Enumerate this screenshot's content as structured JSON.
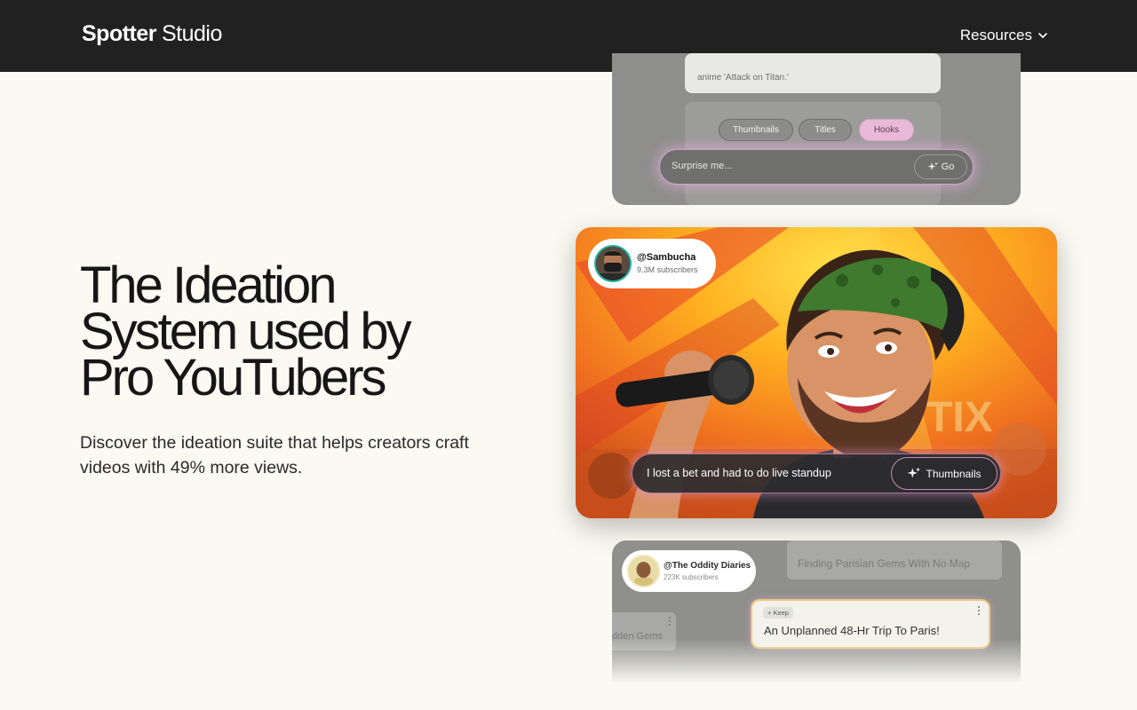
{
  "header": {
    "brand": "Spotter",
    "brand_sub": "Studio",
    "resources_label": "Resources"
  },
  "hero": {
    "title_line1": "The Ideation",
    "title_line2": "System used by",
    "title_line3": "Pro YouTubers",
    "subtitle": "Discover the ideation suite that helps creators craft videos with 49% more views."
  },
  "top_card": {
    "note_text": "anime 'Attack on Titan.'",
    "pills": [
      "Thumbnails",
      "Titles",
      "Hooks"
    ],
    "active_pill": "Hooks",
    "prompt_placeholder": "Surprise me...",
    "go_label": "Go"
  },
  "main_card": {
    "channel_handle": "@Sambucha",
    "channel_subs": "9.3M subscribers",
    "idea_text": "I lost a bet and had to do live standup",
    "mode_button": "Thumbnails"
  },
  "bottom_card": {
    "channel_handle": "@The Oddity Diaries",
    "channel_subs": "223K subscribers",
    "bg_idea_1": "Finding Parisian Gems With No Map",
    "bg_idea_2": "dden Gems",
    "keep_tag": "+ Keep",
    "keep_title": "An Unplanned 48-Hr Trip To Paris!"
  },
  "colors": {
    "header_bg": "#212121",
    "page_bg": "#faf9f2",
    "accent_pink": "#e9b9d8",
    "avatar_ring": "#1eb3a0",
    "keep_border": "#efc77c"
  }
}
